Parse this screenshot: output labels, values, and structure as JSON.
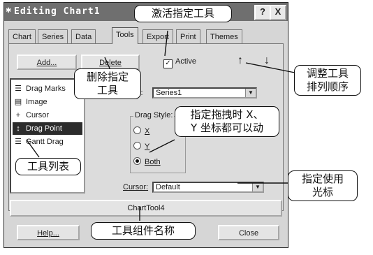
{
  "window": {
    "title": "Editing Chart1",
    "help_glyph": "?",
    "close_glyph": "X"
  },
  "tabs": [
    "Chart",
    "Series",
    "Data",
    "Tools",
    "Export",
    "Print",
    "Themes"
  ],
  "active_tab": "Tools",
  "toolbar": {
    "add_label": "Add...",
    "delete_label": "Delete",
    "active_label": "Active",
    "active_checked": true,
    "up_glyph": "↑",
    "down_glyph": "↓"
  },
  "tool_list": [
    {
      "label": "Drag Marks",
      "icon": "drag-marks-icon",
      "glyph": "☰",
      "selected": false
    },
    {
      "label": "Image",
      "icon": "image-icon",
      "glyph": "▤",
      "selected": false
    },
    {
      "label": "Cursor",
      "icon": "cursor-crosshair-icon",
      "glyph": "+",
      "selected": false
    },
    {
      "label": "Drag Point",
      "icon": "drag-point-icon",
      "glyph": "↕",
      "selected": true
    },
    {
      "label": "Gantt Drag",
      "icon": "gantt-drag-icon",
      "glyph": "☰",
      "selected": false
    }
  ],
  "series": {
    "label_fragment": "s:",
    "value": "Series1"
  },
  "drag_style": {
    "label": "Drag Style:",
    "options": [
      "X",
      "Y",
      "Both"
    ],
    "selected": "Both"
  },
  "cursor": {
    "label": "Cursor:",
    "value": "Default"
  },
  "tool_name": "ChartTool4",
  "footer": {
    "help_label": "Help...",
    "close_label": "Close"
  },
  "annotations": {
    "activate": "激活指定工具",
    "reorder": "调整工具\n排列顺序",
    "delete": "删除指定\n工具",
    "drag_xy": "指定拖拽时 X、\nY 坐标都可以动",
    "tool_list": "工具列表",
    "cursor": "指定使用\n光标",
    "component_name": "工具组件名称"
  },
  "colors": {
    "titlebar": "#6f6f6f",
    "face": "#d6d6d6",
    "selection": "#2c2c2c"
  }
}
